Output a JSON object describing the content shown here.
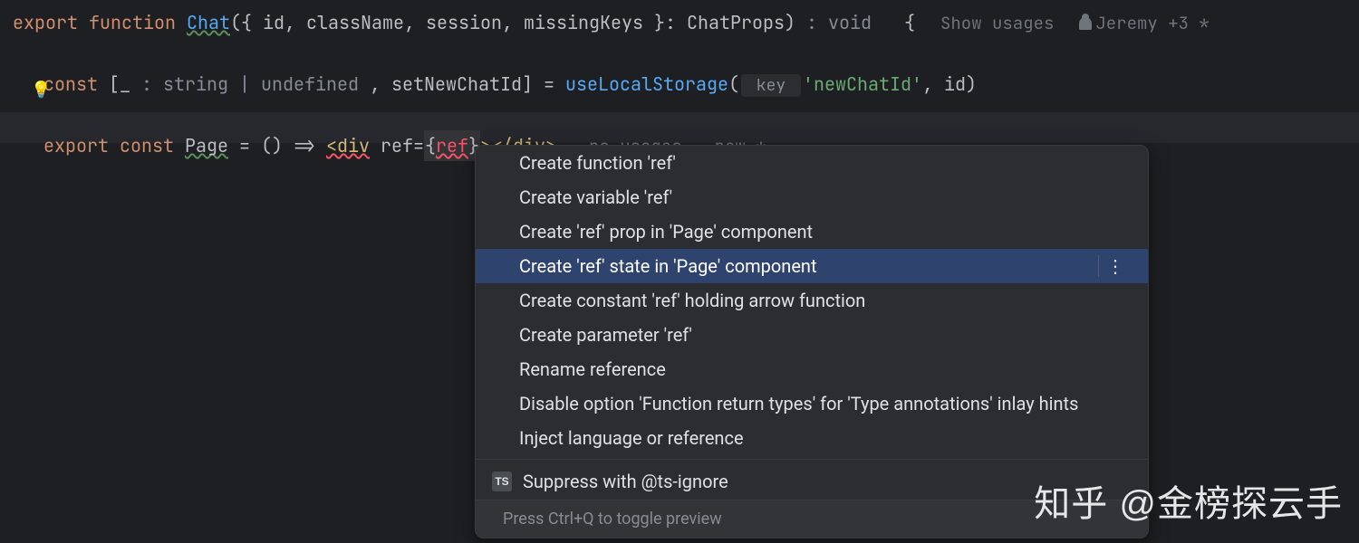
{
  "code": {
    "line1": {
      "kw_export": "export",
      "kw_function": "function",
      "fn_name": "Chat",
      "params_open": "({ ",
      "params_list": "id, className, session, missingKeys",
      "params_close": " }: ",
      "type_name": "ChatProps",
      "paren_close": ")",
      "ret_hint": " : void ",
      "brace": "  {",
      "meta_usages": "Show usages",
      "meta_author": "Jeremy +3 *"
    },
    "line2": {
      "kw_const": "const",
      "bracket_open": " [",
      "underscore": "_",
      "type_hint": " : string | undefined ",
      "comma": ", ",
      "setter": "setNewChatId",
      "bracket_close": "] = ",
      "call": "useLocalStorage",
      "paren_open": "(",
      "key_hint": " key ",
      "str": "'newChatId'",
      "rest": ", id)"
    },
    "line3": {
      "kw_export": "export",
      "kw_const": "const",
      "name": "Page",
      "arrow": " = () => ",
      "tag_open": "<div",
      "sp": " ",
      "attr": "ref",
      "eq": "=",
      "brace_open": "{",
      "ref": "ref",
      "brace_close": "}",
      "tag_close_open": ">",
      "tag_close": "</div>",
      "meta_nousage": "no usages",
      "meta_new": "new *"
    }
  },
  "popup": {
    "items": [
      "Create function 'ref'",
      "Create variable 'ref'",
      "Create 'ref' prop in 'Page' component",
      "Create 'ref' state in 'Page' component",
      "Create constant 'ref' holding arrow function",
      "Create parameter 'ref'",
      "Rename reference",
      "Disable option 'Function return types' for 'Type annotations' inlay hints",
      "Inject language or reference"
    ],
    "selected_index": 3,
    "suppress": "Suppress with @ts-ignore",
    "ts_badge": "TS",
    "footer": "Press Ctrl+Q to toggle preview"
  },
  "watermark": "知乎 @金榜探云手"
}
